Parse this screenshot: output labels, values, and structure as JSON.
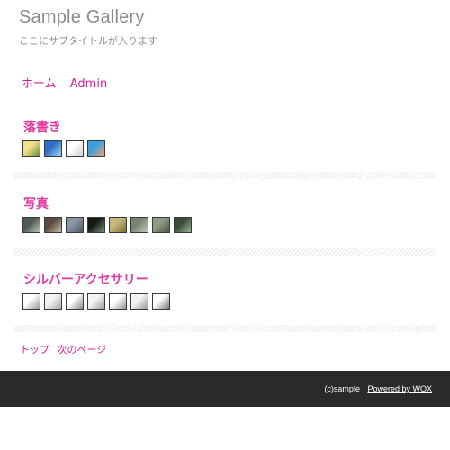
{
  "header": {
    "site_title": "Sample Gallery",
    "subtitle": "ここにサブタイトルが入ります"
  },
  "nav": {
    "home": "ホーム",
    "admin": "Admin"
  },
  "sections": [
    {
      "title": "落書き",
      "thumbnails": [
        {
          "colors": [
            "#f3e08a",
            "#6a8f3a"
          ]
        },
        {
          "colors": [
            "#2f6fc9",
            "#9fd3f5"
          ]
        },
        {
          "colors": [
            "#ffffff",
            "#cfcfcf"
          ]
        },
        {
          "colors": [
            "#3aa0e0",
            "#f0a070"
          ]
        }
      ]
    },
    {
      "title": "写真",
      "thumbnails": [
        {
          "colors": [
            "#4e5a52",
            "#b8c4b8"
          ]
        },
        {
          "colors": [
            "#5a4a42",
            "#c8b8a8"
          ]
        },
        {
          "colors": [
            "#8a95a6",
            "#4c5666"
          ]
        },
        {
          "colors": [
            "#151815",
            "#7a8a7a"
          ]
        },
        {
          "colors": [
            "#c6b87a",
            "#7a6a3a"
          ]
        },
        {
          "colors": [
            "#7a8272",
            "#c4c8b8"
          ]
        },
        {
          "colors": [
            "#8e9a84",
            "#50584a"
          ]
        },
        {
          "colors": [
            "#3a4a3a",
            "#9ab08a"
          ]
        }
      ]
    },
    {
      "title": "シルバーアクセサリー",
      "thumbnails": [
        {
          "colors": [
            "#ffffff",
            "#9a9a9a"
          ]
        },
        {
          "colors": [
            "#f4f4f4",
            "#a8a8a8"
          ]
        },
        {
          "colors": [
            "#ffffff",
            "#8c8c8c"
          ]
        },
        {
          "colors": [
            "#f4f4f4",
            "#a0a0a0"
          ]
        },
        {
          "colors": [
            "#ffffff",
            "#969696"
          ]
        },
        {
          "colors": [
            "#f4f4f4",
            "#9c9c9c"
          ]
        },
        {
          "colors": [
            "#ffffff",
            "#7a7a7a"
          ]
        }
      ]
    }
  ],
  "pager": {
    "top": "トップ",
    "next": "次のページ"
  },
  "footer": {
    "copyright": "(c)sample",
    "powered": "Powered by WOX"
  },
  "colors": {
    "accent": "#e0399f",
    "link": "#d6219b",
    "title_gray": "#8c8c8c",
    "footer_bg": "#2a2a2a"
  }
}
